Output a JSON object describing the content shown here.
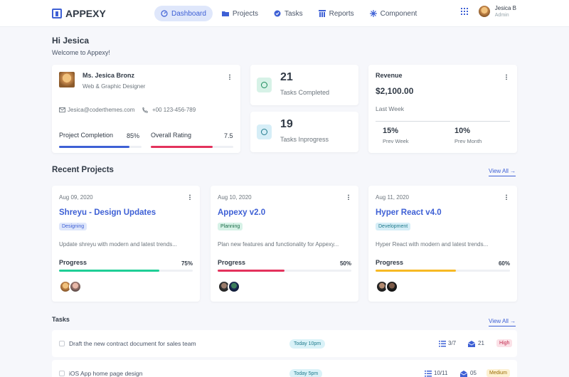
{
  "app": {
    "name": "APPEXY"
  },
  "nav": [
    {
      "label": "Dashboard",
      "icon": "dashboard-icon"
    },
    {
      "label": "Projects",
      "icon": "folder-icon"
    },
    {
      "label": "Tasks",
      "icon": "tasks-icon"
    },
    {
      "label": "Reports",
      "icon": "reports-icon"
    },
    {
      "label": "Component",
      "icon": "component-icon"
    }
  ],
  "user": {
    "name": "Jesica B",
    "role": "Admin"
  },
  "greeting": {
    "title": "Hi Jesica",
    "subtitle": "Welcome to Appexy!"
  },
  "profile": {
    "name": "Ms. Jesica Bronz",
    "title": "Web & Graphic Designer",
    "email": "Jesica@coderthemes.com",
    "phone": "+00 123-456-789",
    "project_completion_label": "Project Completion",
    "project_completion_value": "85%",
    "project_completion_pct": 85,
    "overall_rating_label": "Overall Rating",
    "overall_rating_value": "7.5",
    "overall_rating_pct": 75
  },
  "stats": [
    {
      "value": "21",
      "label": "Tasks Completed"
    },
    {
      "value": "19",
      "label": "Tasks Inprogress"
    }
  ],
  "revenue": {
    "title": "Revenue",
    "amount": "$2,100.00",
    "period": "Last Week",
    "prev_week_value": "15%",
    "prev_week_label": "Prev Week",
    "prev_month_value": "10%",
    "prev_month_label": "Prev Month"
  },
  "recent_projects": {
    "title": "Recent Projects",
    "view_all": "View All →",
    "items": [
      {
        "date": "Aug 09, 2020",
        "title": "Shreyu - Design Updates",
        "badge": "Designing",
        "desc": "Update shreyu with modern and latest trends...",
        "progress_label": "Progress",
        "progress": "75%",
        "progress_pct": 75,
        "color": "#1fce96"
      },
      {
        "date": "Aug 10, 2020",
        "title": "Appexy v2.0",
        "badge": "Planning",
        "desc": "Plan new features and functionality for Appexy...",
        "progress_label": "Progress",
        "progress": "50%",
        "progress_pct": 50,
        "color": "#e3325c"
      },
      {
        "date": "Aug 11, 2020",
        "title": "Hyper React v4.0",
        "badge": "Development",
        "desc": "Hyper React with modern and latest trends...",
        "progress_label": "Progress",
        "progress": "60%",
        "progress_pct": 60,
        "color": "#f7b924"
      }
    ]
  },
  "tasks": {
    "title": "Tasks",
    "view_all": "View All →",
    "items": [
      {
        "title": "Draft the new contract document for sales team",
        "due": "Today 10pm",
        "checklist": "3/7",
        "comments": "21",
        "priority": "High"
      },
      {
        "title": "iOS App home page design",
        "due": "Today 5pm",
        "checklist": "10/11",
        "comments": "05",
        "priority": "Medium"
      }
    ]
  }
}
